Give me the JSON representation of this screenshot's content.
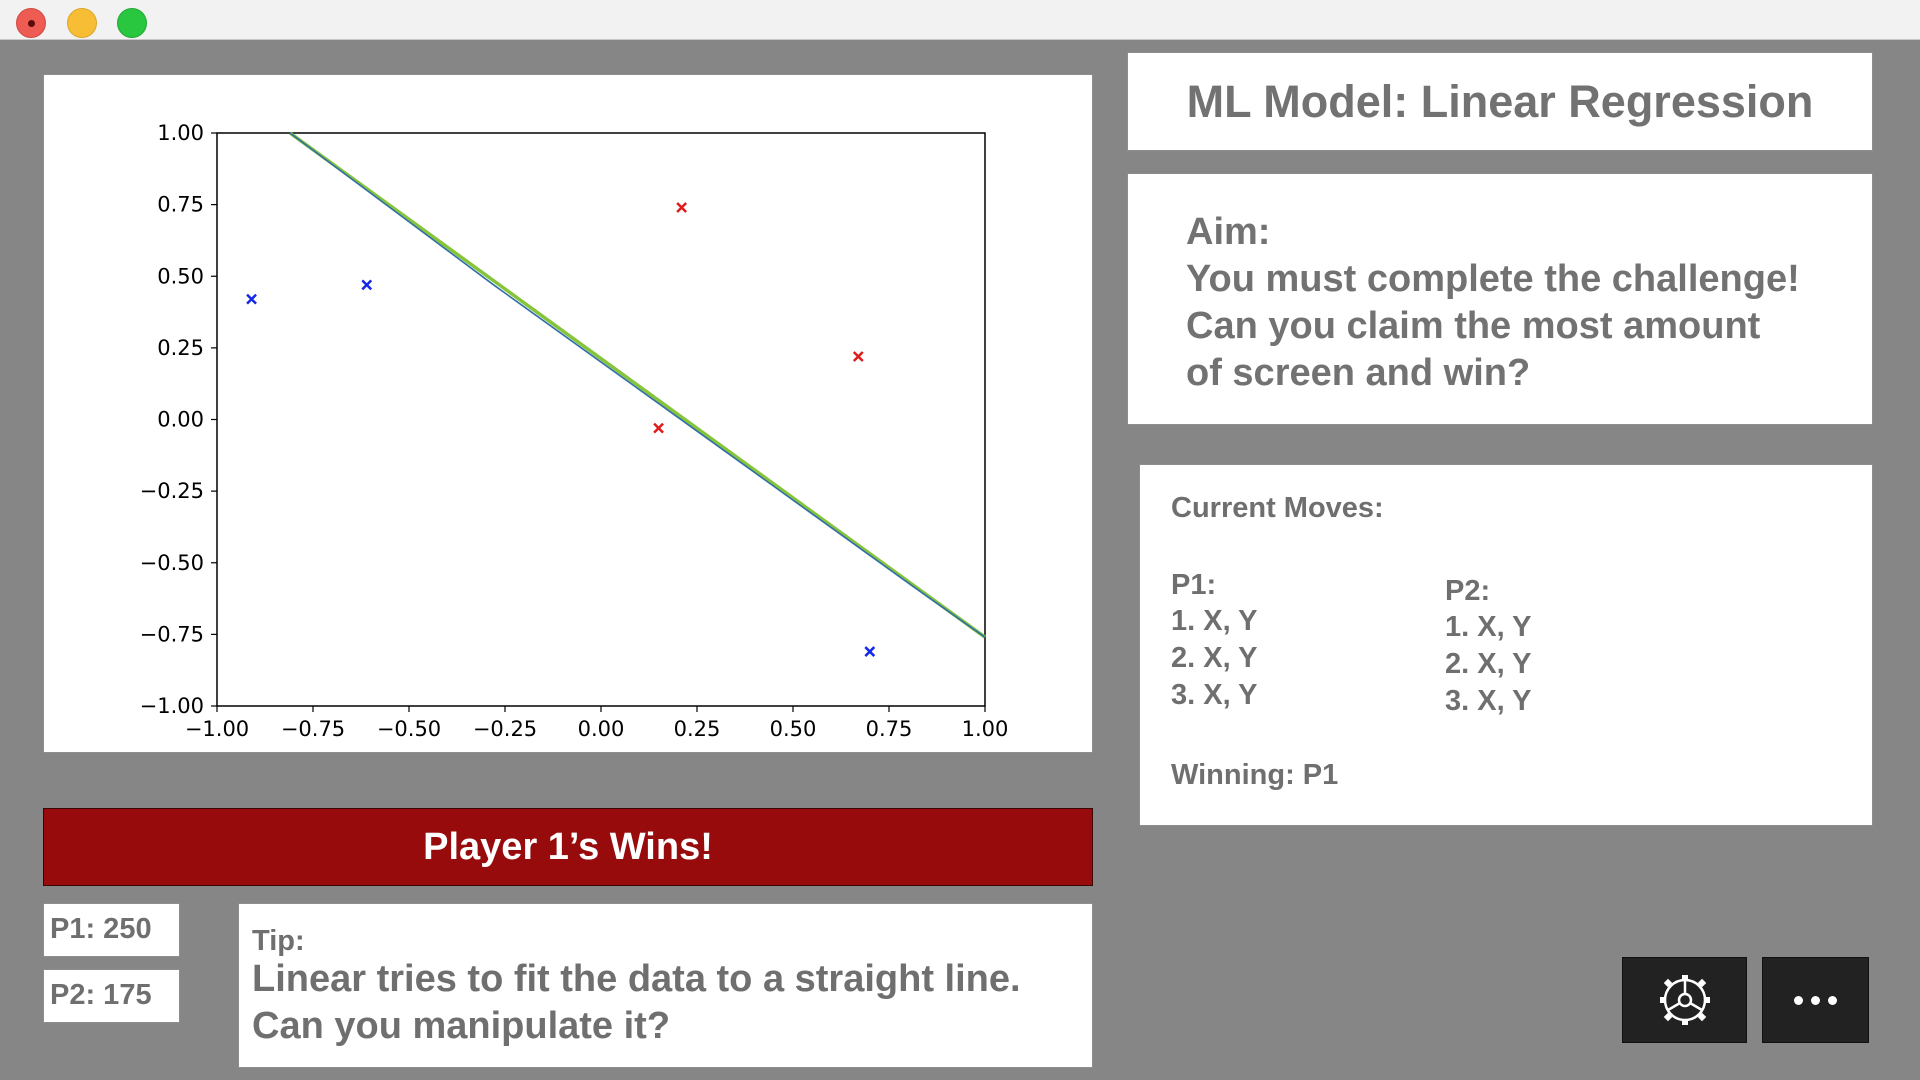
{
  "window": {
    "controls": [
      "close-icon",
      "minimize-icon",
      "maximize-icon"
    ]
  },
  "chart_data": {
    "type": "scatter",
    "xlim": [
      -1.0,
      1.0
    ],
    "ylim": [
      -1.0,
      1.0
    ],
    "xticks": [
      "−1.00",
      "−0.75",
      "−0.50",
      "−0.25",
      "0.00",
      "0.25",
      "0.50",
      "0.75",
      "1.00"
    ],
    "yticks": [
      "1.00",
      "0.75",
      "0.50",
      "0.25",
      "0.00",
      "−0.25",
      "−0.50",
      "−0.75",
      "−1.00"
    ],
    "xtick_values": [
      -1.0,
      -0.75,
      -0.5,
      -0.25,
      0.0,
      0.25,
      0.5,
      0.75,
      1.0
    ],
    "ytick_values": [
      1.0,
      0.75,
      0.5,
      0.25,
      0.0,
      -0.25,
      -0.5,
      -0.75,
      -1.0
    ],
    "grid": false,
    "series": [
      {
        "marker": "x",
        "color": "#1428e6",
        "points": [
          [
            -0.91,
            0.42
          ],
          [
            -0.61,
            0.47
          ],
          [
            0.7,
            -0.81
          ]
        ]
      },
      {
        "marker": "x",
        "color": "#e01b1b",
        "points": [
          [
            0.21,
            0.74
          ],
          [
            0.67,
            0.22
          ],
          [
            0.15,
            -0.03
          ]
        ]
      }
    ],
    "lines": [
      {
        "color": "#86c43a",
        "points": [
          [
            -0.81,
            1.0
          ],
          [
            1.0,
            -0.76
          ]
        ]
      },
      {
        "color": "#2f6ea8",
        "points": [
          [
            -0.81,
            1.0
          ],
          [
            -0.56,
            0.75
          ],
          [
            -0.28,
            0.47
          ],
          [
            -0.01,
            0.21
          ],
          [
            0.26,
            -0.05
          ],
          [
            0.54,
            -0.32
          ],
          [
            0.81,
            -0.58
          ],
          [
            1.0,
            -0.76
          ]
        ]
      }
    ]
  },
  "header": {
    "title": "ML Model: Linear Regression"
  },
  "aim": {
    "lines": [
      "Aim:",
      "You must complete the challenge!",
      "Can you claim the most amount",
      "of screen and win?"
    ]
  },
  "moves": {
    "title": "Current Moves:",
    "p1": {
      "label": "P1:",
      "items": [
        "1.  X, Y",
        "2.  X, Y",
        "3.  X, Y"
      ]
    },
    "p2": {
      "label": "P2:",
      "items": [
        "1.  X, Y",
        "2.  X, Y",
        "3.  X, Y"
      ]
    },
    "winning": "Winning: P1"
  },
  "banner": {
    "text": "Player 1’s Wins!"
  },
  "scores": {
    "p1": "P1: 250",
    "p2": "P2: 175"
  },
  "tip": {
    "label": "Tip:",
    "lines": [
      "Linear tries to fit the data to a straight line.",
      "Can you manipulate it?"
    ]
  },
  "buttons": {
    "settings_icon": "gear-icon",
    "more_icon": "more-dots-icon"
  }
}
